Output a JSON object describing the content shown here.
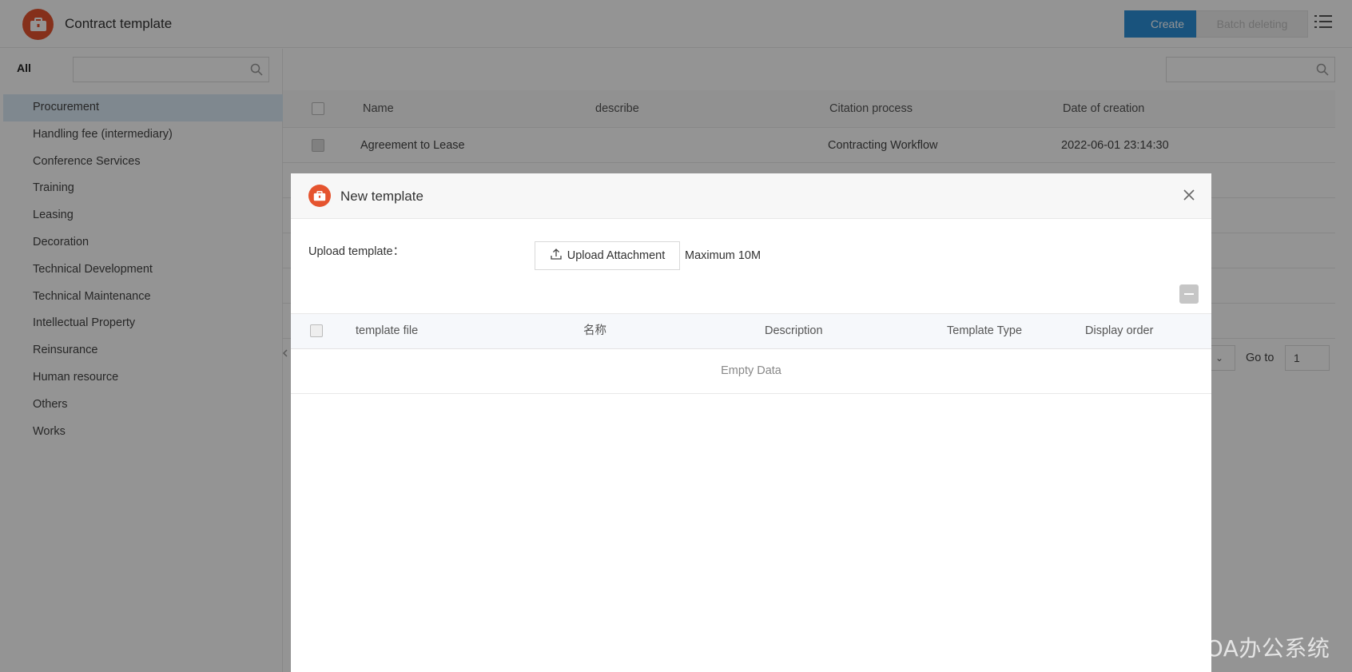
{
  "app": {
    "title": "Contract template",
    "create_label": "Create",
    "batch_delete_label": "Batch deleting"
  },
  "sidebar": {
    "all_label": "All",
    "search_placeholder": "",
    "items": [
      {
        "label": "Procurement",
        "active": true
      },
      {
        "label": "Handling fee (intermediary)"
      },
      {
        "label": "Conference Services"
      },
      {
        "label": "Training"
      },
      {
        "label": "Leasing"
      },
      {
        "label": "Decoration"
      },
      {
        "label": "Technical Development"
      },
      {
        "label": "Technical Maintenance"
      },
      {
        "label": "Intellectual Property"
      },
      {
        "label": "Reinsurance"
      },
      {
        "label": "Human resource"
      },
      {
        "label": "Others"
      },
      {
        "label": "Works"
      }
    ]
  },
  "main": {
    "search_placeholder": "",
    "columns": [
      "Name",
      "describe",
      "Citation process",
      "Date of creation"
    ],
    "rows": [
      {
        "name": "Agreement to Lease",
        "describe": "",
        "process": "Contracting Workflow",
        "date": "2022-06-01 23:14:30"
      }
    ],
    "pager": {
      "goto_label": "Go to",
      "goto_value": "1"
    }
  },
  "modal": {
    "title": "New template",
    "upload_label": "Upload template：",
    "upload_button": "Upload Attachment",
    "max_size": "Maximum 10M",
    "columns": [
      "template file",
      "名称",
      "Description",
      "Template Type",
      "Display order"
    ],
    "empty_text": "Empty Data"
  },
  "watermark": "CSDN @泛微OA办公系统",
  "colors": {
    "brand": "#e5542f",
    "primary": "#2b8fd8",
    "active_item": "#dbeaf7"
  }
}
